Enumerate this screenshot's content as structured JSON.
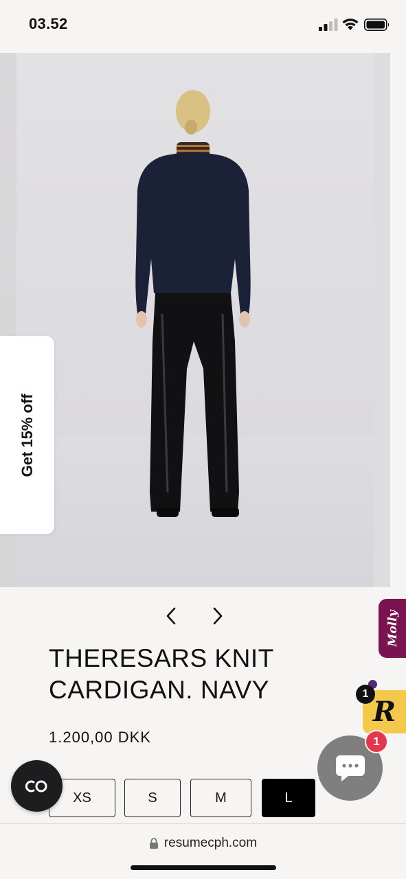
{
  "status_bar": {
    "time": "03.52"
  },
  "promo": {
    "label": "Get 15% off"
  },
  "product": {
    "title": "THERESARS KNIT CARDIGAN. NAVY",
    "price": "1.200,00 DKK"
  },
  "sizes": [
    {
      "label": "XS",
      "selected": false
    },
    {
      "label": "S",
      "selected": false
    },
    {
      "label": "M",
      "selected": false
    },
    {
      "label": "L",
      "selected": true
    }
  ],
  "widgets": {
    "molly_label": "Molly",
    "r_letter": "R",
    "r_count": "1",
    "chat_count": "1"
  },
  "browser": {
    "url": "resumecph.com"
  },
  "colors": {
    "background": "#f6f5f3",
    "selected_size": "#000000",
    "molly_tab": "#7a1450",
    "r_widget": "#f4c84a",
    "chat_badge": "#e6364d"
  }
}
